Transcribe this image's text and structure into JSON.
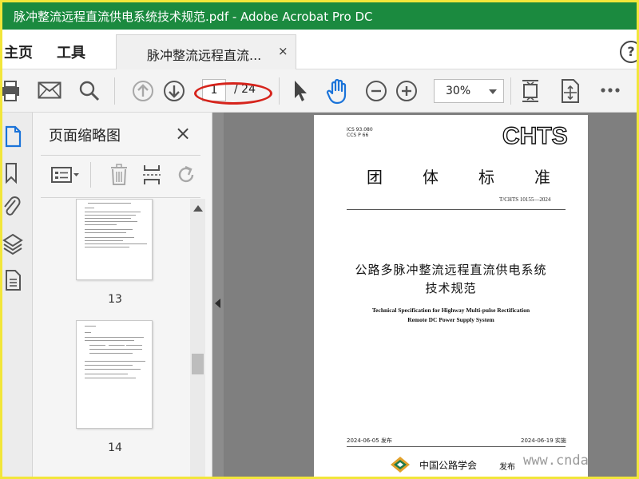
{
  "window": {
    "title": "脉冲整流远程直流供电系统技术规范.pdf - Adobe Acrobat Pro DC"
  },
  "nav": {
    "home": "主页",
    "tools": "工具",
    "doc_tab": "脉冲整流远程直流...",
    "close": "×",
    "help": "?"
  },
  "toolbar": {
    "page_current": "1",
    "page_total": "/ 24",
    "zoom": "30%",
    "icons": [
      "print-icon",
      "email-icon",
      "search-icon",
      "page-up-icon",
      "page-down-icon",
      "select-arrow-icon",
      "hand-tool-icon",
      "zoom-out-icon",
      "zoom-in-icon",
      "fit-page-icon",
      "scroll-mode-icon",
      "more-icon"
    ]
  },
  "panel": {
    "title": "页面缩略图",
    "close": "×",
    "thumbnails": [
      {
        "label": "13"
      },
      {
        "label": "14"
      }
    ]
  },
  "document": {
    "ics_line1": "ICS 93.080",
    "ics_line2": "CCS P 66",
    "brand": "CHTS",
    "group_chars": [
      "团",
      "体",
      "标",
      "准"
    ],
    "code": "T/CHTS 10155—2024",
    "title_cn_line1": "公路多脉冲整流远程直流供电系统",
    "title_cn_line2": "技术规范",
    "title_en_line1": "Technical Specification for Highway Multi-pulse Rectification",
    "title_en_line2": "Remote DC Power Supply System",
    "issue_date": "2024-06-05 发布",
    "impl_date": "2024-06-19 实施",
    "org": "中国公路学会",
    "publish": "发布"
  },
  "watermark": "www.cnda",
  "colors": {
    "titlebar": "#1b8a3f",
    "accent_blue": "#1a73d9",
    "annotation_red": "#d6241c",
    "frame_yellow": "#f2e63a"
  }
}
